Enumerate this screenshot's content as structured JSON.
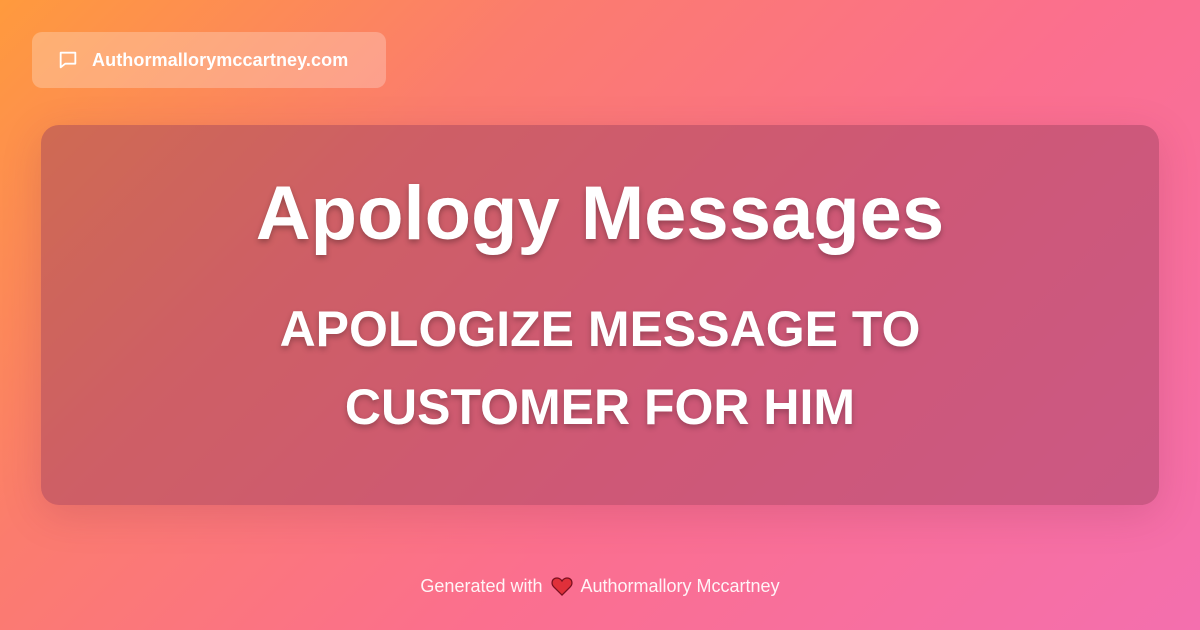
{
  "site": {
    "icon": "chat-bubble-icon",
    "name": "Authormallorymccartney.com"
  },
  "card": {
    "title": "Apology Messages",
    "subtitle": "APOLOGIZE MESSAGE TO CUSTOMER FOR HIM"
  },
  "footer": {
    "prefix": "Generated with",
    "heart_icon": "heart-icon",
    "author": "Authormallory Mccartney"
  },
  "colors": {
    "gradient_start": "#ff9a3d",
    "gradient_end": "#f46fae",
    "card_overlay": "#963c5a",
    "heart": "#e0303a"
  }
}
